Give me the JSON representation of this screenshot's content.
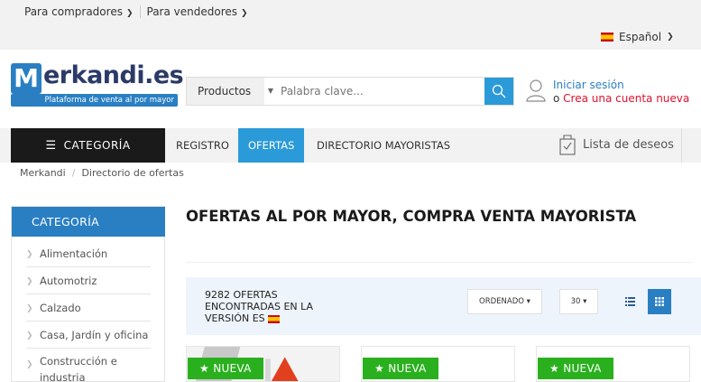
{
  "topbar": {
    "buyers": "Para compradores",
    "sellers": "Para vendedores",
    "language": "Español"
  },
  "logo": {
    "letter": "M",
    "name": "erkandi.es",
    "tagline": "Plataforma de venta al por mayor"
  },
  "search": {
    "category": "Productos",
    "placeholder": "Palabra clave..."
  },
  "account": {
    "login": "Iniciar sesión",
    "or": "o ",
    "register": "Crea una cuenta nueva"
  },
  "nav": {
    "category": "CATEGORÍA",
    "items": [
      "REGISTRO",
      "OFERTAS",
      "DIRECTORIO MAYORISTAS"
    ],
    "wishlist": "Lista de deseos"
  },
  "breadcrumb": [
    "Merkandi",
    "Directorio de ofertas"
  ],
  "sidebar": {
    "title": "CATEGORÍA",
    "items": [
      "Alimentación",
      "Automotriz",
      "Calzado",
      "Casa, Jardín y oficina",
      "Construcción e industria"
    ]
  },
  "main": {
    "title": "OFERTAS AL POR MAYOR, COMPRA VENTA MAYORISTA",
    "results": "9282 OFERTAS ENCONTRADAS EN LA VERSIÓN ES",
    "sort_label": "ORDENADO",
    "per_page": "30"
  },
  "cards": [
    {
      "badge": "NUEVA"
    },
    {
      "badge": "NUEVA"
    },
    {
      "badge": "NUEVA"
    }
  ],
  "colors": {
    "primary": "#2a7fc3",
    "accent_blue": "#2b9ad8",
    "badge_green": "#2ab01e",
    "register_red": "#e0102b",
    "nav_dark": "#1a1a1a"
  }
}
